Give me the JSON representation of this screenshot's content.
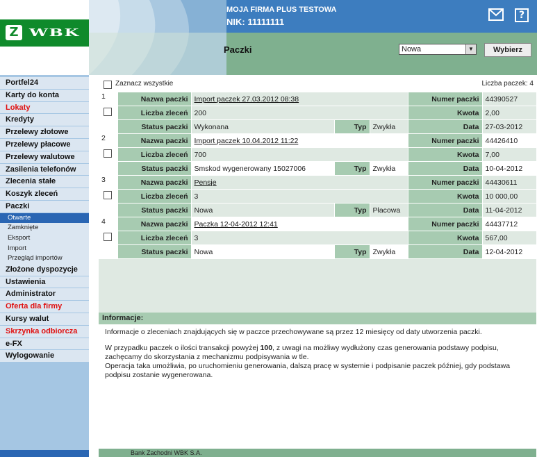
{
  "header": {
    "logo_text": "WBK",
    "company": "MOJA FIRMA PLUS TESTOWA",
    "nik": "NIK: 11111111",
    "page_title": "Paczki",
    "status_select": "Nowa",
    "select_button": "Wybierz",
    "help_glyph": "?"
  },
  "sidebar": {
    "items": [
      {
        "label": "Portfel24",
        "red": false
      },
      {
        "label": "Karty do konta",
        "red": false
      },
      {
        "label": "Lokaty",
        "red": true
      },
      {
        "label": "Kredyty",
        "red": false
      },
      {
        "label": "Przelewy złotowe",
        "red": false
      },
      {
        "label": "Przelewy płacowe",
        "red": false
      },
      {
        "label": "Przelewy walutowe",
        "red": false
      },
      {
        "label": "Zasilenia telefonów",
        "red": false
      },
      {
        "label": "Zlecenia stałe",
        "red": false
      },
      {
        "label": "Koszyk zleceń",
        "red": false
      },
      {
        "label": "Paczki",
        "red": false
      }
    ],
    "subitems": [
      "Otwarte",
      "Zamknięte",
      "Eksport",
      "Import",
      "Przegląd importów"
    ],
    "items_after": [
      {
        "label": "Złożone dyspozycje",
        "red": false
      },
      {
        "label": "Ustawienia",
        "red": false
      },
      {
        "label": "Administrator",
        "red": false
      },
      {
        "label": "Oferta dla firmy",
        "red": true
      },
      {
        "label": "Kursy walut",
        "red": false
      },
      {
        "label": "Skrzynka odbiorcza",
        "red": true
      },
      {
        "label": "e-FX",
        "red": false
      },
      {
        "label": "Wylogowanie",
        "red": false
      }
    ]
  },
  "main": {
    "select_all": "Zaznacz wszystkie",
    "count": "Liczba paczek: 4",
    "labels": {
      "name": "Nazwa paczki",
      "orders": "Liczba zleceń",
      "status": "Status paczki",
      "type": "Typ",
      "number": "Numer paczki",
      "amount": "Kwota",
      "date": "Data"
    },
    "packages": [
      {
        "idx": "1",
        "name": "Import paczek 27.03.2012 08:38",
        "orders": "200",
        "status": "Wykonana",
        "type": "Zwykła",
        "number": "44390527",
        "amount": "2,00",
        "date": "27-03-2012"
      },
      {
        "idx": "2",
        "name": "Import paczek 10.04.2012 11:22",
        "orders": "700",
        "status": "Smskod wygenerowany 15027006",
        "type": "Zwykła",
        "number": "44426410",
        "amount": "7,00",
        "date": "10-04-2012"
      },
      {
        "idx": "3",
        "name": "Pensje",
        "orders": "3",
        "status": "Nowa",
        "type": "Płacowa",
        "number": "44430611",
        "amount": "10 000,00",
        "date": "11-04-2012"
      },
      {
        "idx": "4",
        "name": "Paczka 12-04-2012 12:41",
        "orders": "3",
        "status": "Nowa",
        "type": "Zwykła",
        "number": "44437712",
        "amount": "567,00",
        "date": "12-04-2012"
      }
    ]
  },
  "info": {
    "title": "Informacje:",
    "p1": "Informacje o zleceniach znajdujących się w paczce przechowywane są przez 12 miesięcy od daty utworzenia paczki.",
    "p2a": "W przypadku paczek o ilości transakcji powyżej ",
    "p2b": "100",
    "p2c": ", z uwagi na możliwy wydłużony czas generowania podstawy podpisu, zachęcamy do skorzystania z mechanizmu podpisywania w tle.",
    "p3": "Operacja taka umożliwia, po uruchomieniu generowania, dalszą pracę w systemie i podpisanie paczek później, gdy podstawa podpisu zostanie wygenerowana."
  },
  "footer": "Bank Zachodni WBK S.A."
}
